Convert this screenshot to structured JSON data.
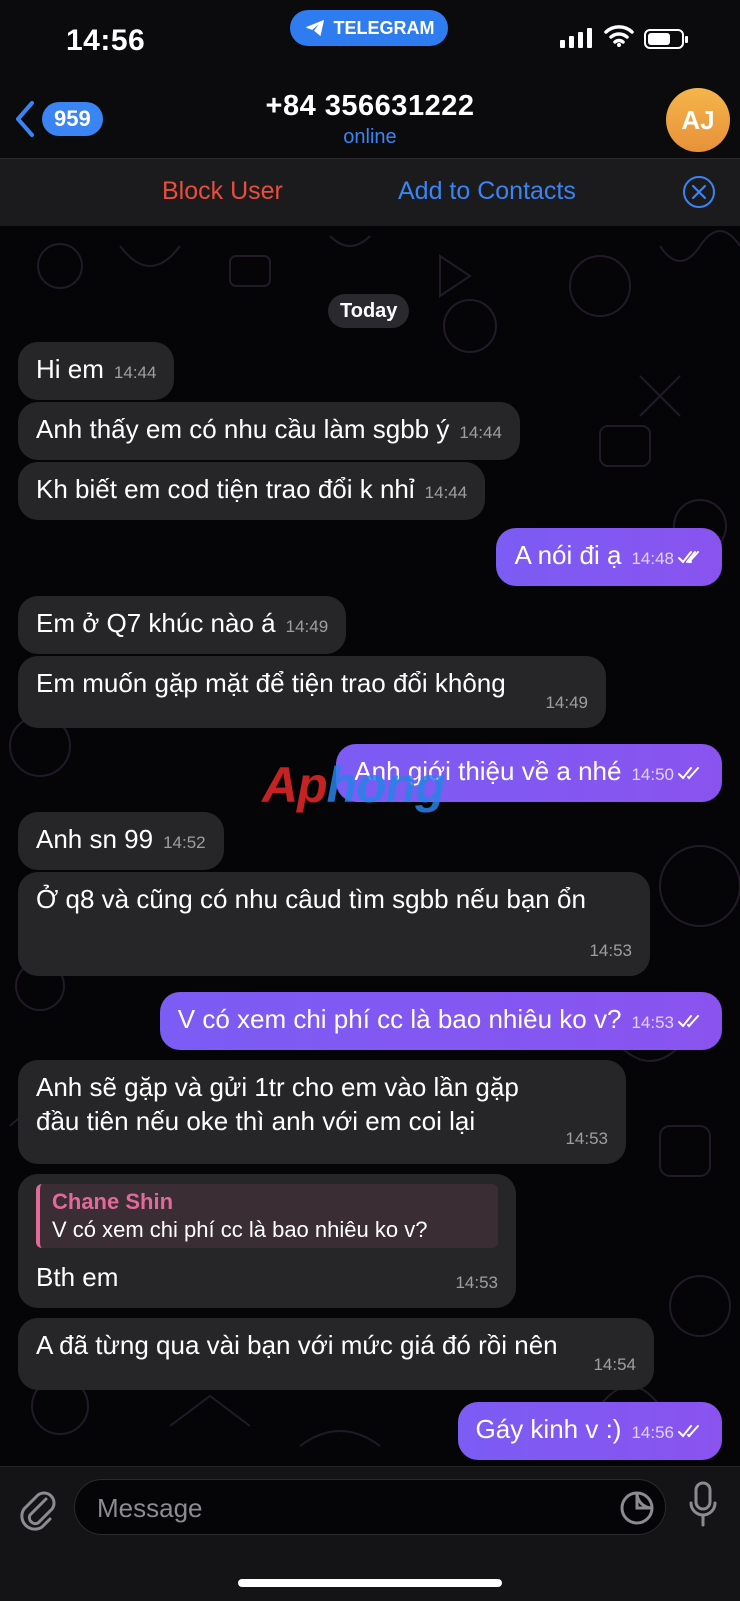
{
  "status_bar": {
    "time": "14:56",
    "app_pill": "TELEGRAM"
  },
  "header": {
    "back_count": "959",
    "title": "+84 356631222",
    "subtitle": "online",
    "avatar_initials": "AJ"
  },
  "action_bar": {
    "block_label": "Block User",
    "add_label": "Add to Contacts"
  },
  "chat": {
    "date_label": "Today",
    "messages": [
      {
        "dir": "in",
        "text": "Hi em",
        "time": "14:44"
      },
      {
        "dir": "in",
        "text": "Anh thấy em có nhu cầu làm sgbb ý",
        "time": "14:44"
      },
      {
        "dir": "in",
        "text": "Kh biết em cod tiện trao đổi k nhỉ",
        "time": "14:44"
      },
      {
        "dir": "out",
        "text": "A nói đi ạ",
        "time": "14:48"
      },
      {
        "dir": "in",
        "text": "Em ở Q7 khúc nào á",
        "time": "14:49"
      },
      {
        "dir": "in",
        "text": "Em muốn gặp mặt để tiện trao đổi không",
        "time": "14:49"
      },
      {
        "dir": "out",
        "text": "Anh giới thiệu về a nhé",
        "time": "14:50"
      },
      {
        "dir": "in",
        "text": "Anh sn 99",
        "time": "14:52"
      },
      {
        "dir": "in",
        "text": "Ở q8 và cũng có nhu câud tìm sgbb nếu bạn ổn",
        "time": "14:53"
      },
      {
        "dir": "out",
        "text": "V có xem chi phí cc là bao nhiêu ko v?",
        "time": "14:53"
      },
      {
        "dir": "in",
        "text": "Anh sẽ gặp và gửi 1tr cho em vào lần gặp đầu tiên nếu oke thì anh với em coi lại",
        "time": "14:53"
      },
      {
        "dir": "in",
        "reply_name": "Chane Shin",
        "reply_text": "V có xem chi phí cc là bao nhiêu ko v?",
        "text": "Bth em",
        "time": "14:53"
      },
      {
        "dir": "in",
        "text": "A đã từng qua vài bạn với mức giá đó rồi nên",
        "time": "14:54"
      },
      {
        "dir": "out",
        "text": "Gáy kinh v :)",
        "time": "14:56"
      }
    ],
    "watermark": "Aphong"
  },
  "input_bar": {
    "placeholder": "Message"
  }
}
